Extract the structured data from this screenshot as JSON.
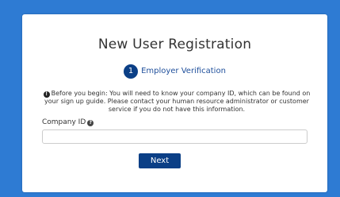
{
  "background_color": "#2e7bd3",
  "accent_color": "#0b3f86",
  "title": "New User Registration",
  "step": {
    "number": "1",
    "label": "Employer Verification"
  },
  "notice": {
    "icon": "info-circle-icon",
    "icon_glyph": "!",
    "text": "Before you begin: You will need to know your company ID, which can be found on your sign up guide. Please contact your human resource administrator or customer service if you do not have this information."
  },
  "company_id_field": {
    "label": "Company ID",
    "help_icon": "question-circle-icon",
    "help_glyph": "?",
    "value": "",
    "placeholder": ""
  },
  "next_button": {
    "label": "Next"
  }
}
